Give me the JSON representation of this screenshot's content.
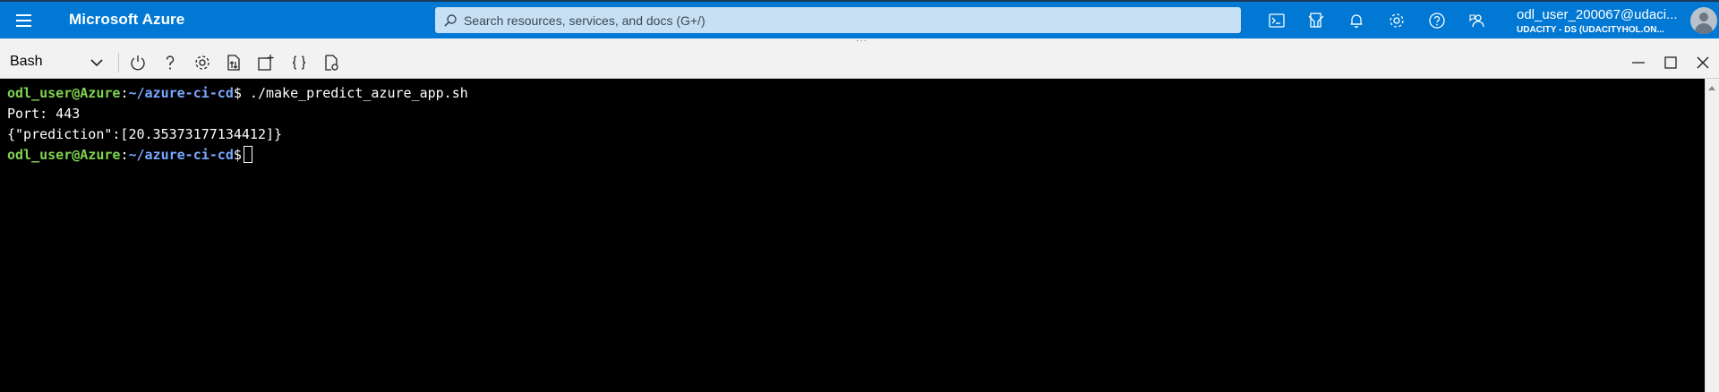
{
  "topbar": {
    "brand": "Microsoft Azure",
    "search_placeholder": "Search resources, services, and docs (G+/)",
    "icons": [
      "cloud-shell-icon",
      "directory-filter-icon",
      "notifications-icon",
      "settings-icon",
      "help-icon",
      "feedback-icon"
    ],
    "account_name": "odl_user_200067@udaci...",
    "account_directory": "UDACITY - DS (UDACITYHOL.ON..."
  },
  "shell": {
    "selected_shell": "Bash",
    "tools": [
      "restart-icon",
      "help-icon",
      "settings-icon",
      "upload-download-icon",
      "open-new-session-icon",
      "editor-braces-icon",
      "web-preview-icon"
    ],
    "window_controls": [
      "minimize-icon",
      "maximize-icon",
      "close-icon"
    ]
  },
  "terminal": {
    "prompt_user": "odl_user@Azure",
    "prompt_sep": ":",
    "prompt_path": "~/azure-ci-cd",
    "prompt_sign": "$",
    "command": " ./make_predict_azure_app.sh",
    "output_1": "Port: 443",
    "output_2": "{\"prediction\":[20.35373177134412]}"
  },
  "colors": {
    "azure_blue": "#0078d4",
    "search_bg": "#c7e0f4",
    "prompt_user": "#7fd44f",
    "prompt_path": "#7aa7ff"
  }
}
